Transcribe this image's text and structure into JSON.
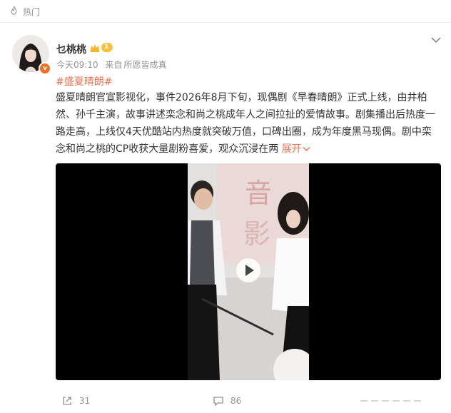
{
  "hot": {
    "label": "热门",
    "icon": "flame-icon"
  },
  "post": {
    "author": {
      "name": "乜桃桃",
      "vip_level": "1"
    },
    "meta": {
      "time": "今天09:10",
      "source_prefix": "来自",
      "source": "所愿皆成真"
    },
    "hashtag": "#盛夏晴朗#",
    "text": "盛夏晴朗官宣影视化，事件2026年8月下旬，现偶剧《早春晴朗》正式上线，由井柏然、孙千主演，故事讲述栾念和尚之桃成年人之间拉扯的爱情故事。剧集播出后热度一路走高，上线仅4天优酷站内热度就突破万值，口碑出圈，成为年度黑马现偶。剧中栾念和尚之桃的CP收获大量剧粉喜爱，观众沉浸在两",
    "expand_label": "展开",
    "video": {
      "icon": "play-icon"
    }
  },
  "footer": {
    "repost_count": "31",
    "comment_count": "86"
  }
}
